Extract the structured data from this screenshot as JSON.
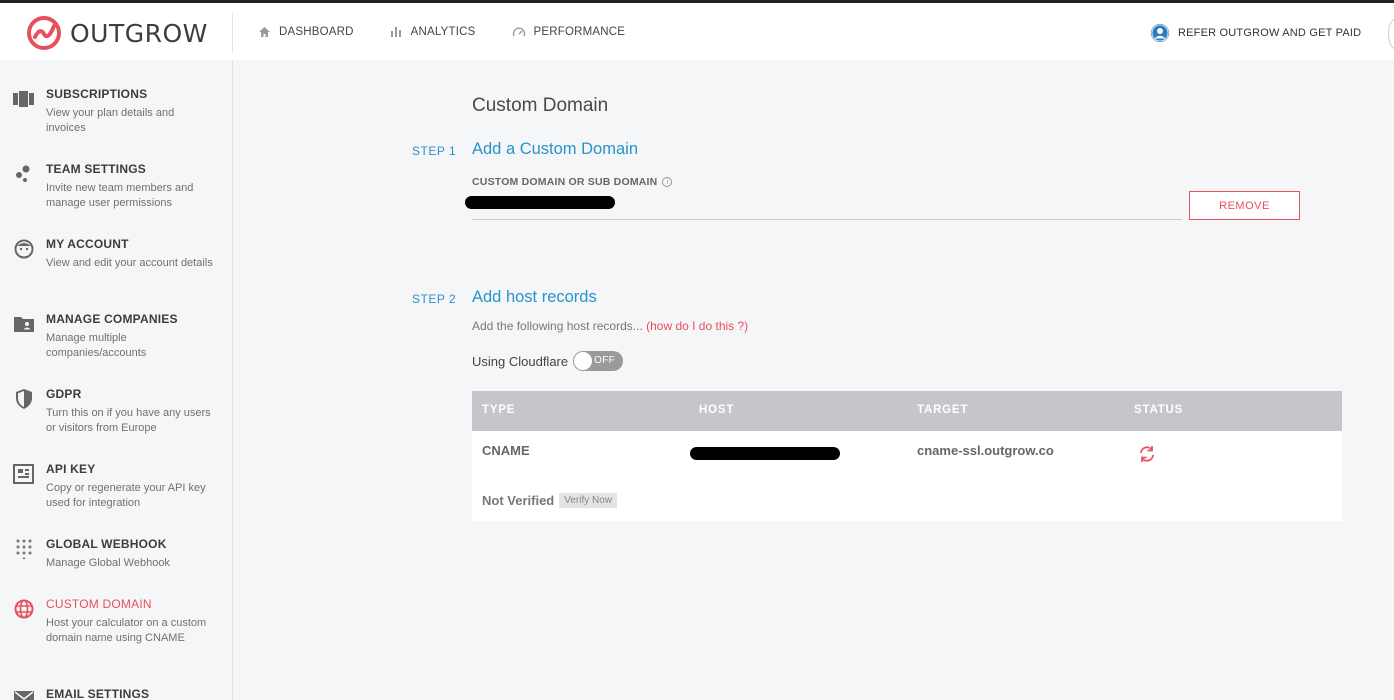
{
  "brand": {
    "name": "OUTGROW",
    "accent": "#e8505b",
    "link_blue": "#2a93c9"
  },
  "nav": [
    {
      "label": "DASHBOARD",
      "icon": "home-icon"
    },
    {
      "label": "ANALYTICS",
      "icon": "bar-chart-icon"
    },
    {
      "label": "PERFORMANCE",
      "icon": "speedometer-icon"
    }
  ],
  "refer": {
    "label": "REFER OUTGROW AND GET PAID",
    "icon": "user-circle-icon"
  },
  "sidebar": [
    {
      "title": "SUBSCRIPTIONS",
      "desc": "View your plan details and invoices",
      "icon": "subscriptions-icon"
    },
    {
      "title": "TEAM SETTINGS",
      "desc": "Invite new team members and manage user permissions",
      "icon": "team-icon"
    },
    {
      "title": "MY ACCOUNT",
      "desc": "View and edit your account details",
      "icon": "face-icon"
    },
    {
      "title": "MANAGE COMPANIES",
      "desc": "Manage multiple companies/accounts",
      "icon": "folder-user-icon"
    },
    {
      "title": "GDPR",
      "desc": "Turn this on if you have any users or visitors from Europe",
      "icon": "shield-icon"
    },
    {
      "title": "API KEY",
      "desc": "Copy or regenerate your API key used for integration",
      "icon": "api-key-icon"
    },
    {
      "title": "GLOBAL WEBHOOK",
      "desc": "Manage Global Webhook",
      "icon": "dots-grid-icon"
    },
    {
      "title": "CUSTOM DOMAIN",
      "desc": "Host your calculator on a custom domain name using CNAME",
      "icon": "globe-icon",
      "active": true
    },
    {
      "title": "EMAIL SETTINGS",
      "desc": "",
      "icon": "envelope-icon"
    }
  ],
  "main": {
    "title": "Custom Domain",
    "step1": {
      "label": "STEP 1",
      "title": "Add a Custom Domain",
      "field_label": "CUSTOM DOMAIN OR SUB DOMAIN",
      "remove_label": "REMOVE"
    },
    "step2": {
      "label": "STEP 2",
      "title": "Add host records",
      "help": "Add the following host records...",
      "help_link": "(how do I do this ?)",
      "cloudflare_label": "Using Cloudflare",
      "toggle_label": "OFF",
      "table": {
        "headers": [
          "TYPE",
          "HOST",
          "TARGET",
          "STATUS"
        ],
        "row": {
          "type": "CNAME",
          "target": "cname-ssl.outgrow.co"
        },
        "not_verified": "Not Verified",
        "verify_label": "Verify Now"
      }
    }
  }
}
